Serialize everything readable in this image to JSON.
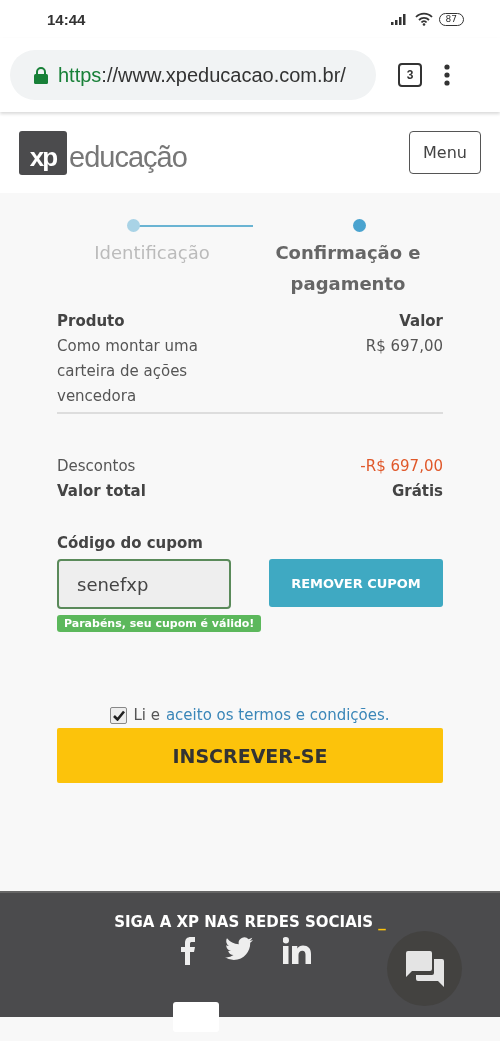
{
  "status_bar": {
    "time": "14:44",
    "battery": "87"
  },
  "browser": {
    "url_scheme": "https",
    "url_rest": "://www.xpeducacao.com.br/",
    "tab_count": "3"
  },
  "header": {
    "logo_mark": "xp",
    "logo_text": "educação",
    "menu_button": "Menu"
  },
  "steps": [
    {
      "label": "Identificação",
      "selected": false
    },
    {
      "label": "Confirmação e pagamento",
      "selected": true
    }
  ],
  "order": {
    "columns": [
      "Produto",
      "Valor"
    ],
    "product": "Como montar uma carteira de ações vencedora",
    "price": "R$ 697,00"
  },
  "summary": [
    {
      "label": "Descontos",
      "value": "-R$ 697,00",
      "kind": "discount"
    },
    {
      "label": "Valor total",
      "value": "Grátis",
      "kind": "total"
    }
  ],
  "coupon": {
    "label": "Código do cupom",
    "value": "senefxp",
    "button": "REMOVER CUPOM",
    "message": "Parabéns, seu cupom é válido!"
  },
  "terms": {
    "checked": true,
    "text": "Li e",
    "link": "aceito os termos e condições."
  },
  "submit_button": "INSCREVER-SE",
  "footer": {
    "title": "SIGA A XP NAS REDES SOCIAIS",
    "accent": "_"
  }
}
